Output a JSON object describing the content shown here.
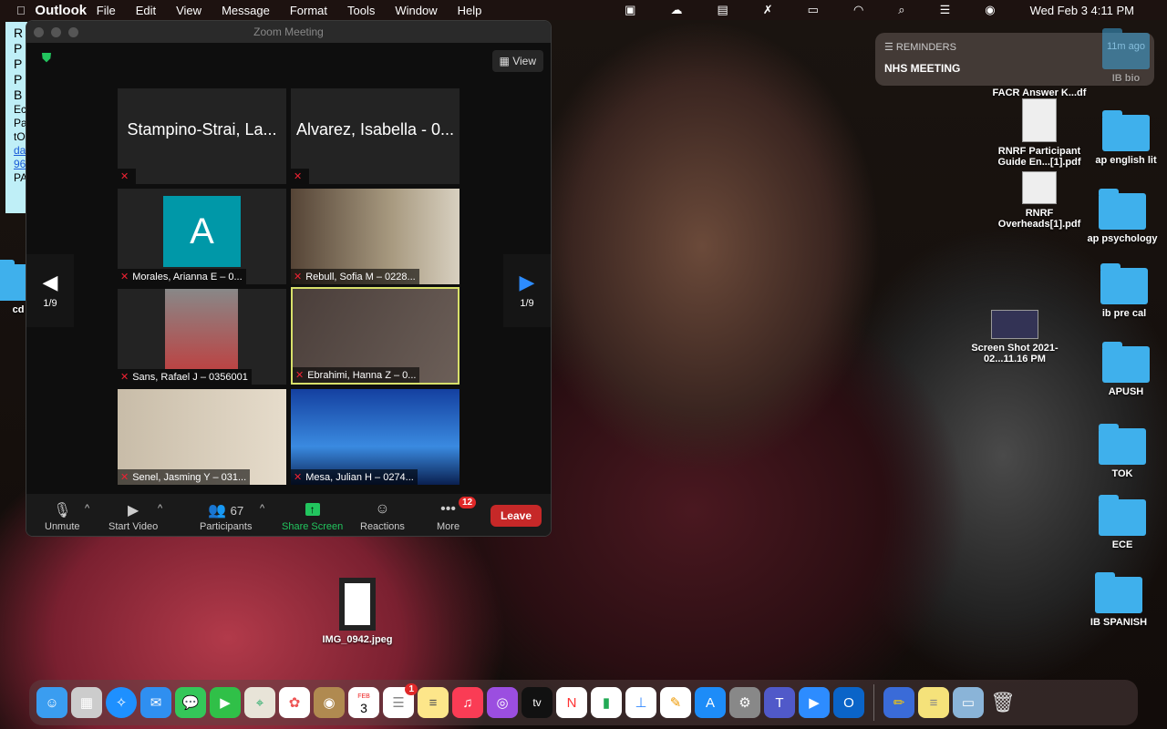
{
  "menubar": {
    "app": "Outlook",
    "items": [
      "File",
      "Edit",
      "View",
      "Message",
      "Format",
      "Tools",
      "Window",
      "Help"
    ],
    "datetime": "Wed Feb 3  4:11 PM"
  },
  "sticky": {
    "lines": [
      "R",
      "P",
      "P",
      "P",
      "B",
      "Ec",
      "Pa",
      "tO",
      "da",
      "96",
      "PA"
    ]
  },
  "zoom": {
    "title": "Zoom Meeting",
    "view_label": "View",
    "page": "1/9",
    "tiles": [
      {
        "name": "Stampino-Strai, La...",
        "label": ""
      },
      {
        "name": "Alvarez, Isabella - 0...",
        "label": ""
      },
      {
        "label": "Morales, Arianna E – 0...",
        "avatar": "A"
      },
      {
        "label": "Rebull, Sofia M – 0228..."
      },
      {
        "label": "Sans, Rafael J – 0356001"
      },
      {
        "label": "Ebrahimi, Hanna Z – 0..."
      },
      {
        "label": "Senel, Jasming Y – 031..."
      },
      {
        "label": "Mesa, Julian H – 0274..."
      }
    ],
    "toolbar": {
      "unmute": "Unmute",
      "start_video": "Start Video",
      "participants": "Participants",
      "participant_count": "67",
      "share": "Share Screen",
      "reactions": "Reactions",
      "more": "More",
      "more_badge": "12",
      "leave": "Leave"
    }
  },
  "notification": {
    "app": "REMINDERS",
    "time": "11m ago",
    "title": "NHS MEETING"
  },
  "desktop": {
    "files": [
      "FACR Answer K...df",
      "RNRF Participant Guide En...[1].pdf",
      "RNRF Overheads[1].pdf",
      "Screen Shot 2021-02...11.16 PM",
      "IMG_0942.jpeg"
    ],
    "folders": [
      "IB bio",
      "ap english lit",
      "ap psychology",
      "ib pre cal",
      "APUSH",
      "TOK",
      "ECE",
      "IB SPANISH"
    ],
    "left_folder": "cd"
  },
  "dock": {
    "calendar_month": "FEB",
    "calendar_day": "3",
    "reminders_badge": "1",
    "tv_label": "tv"
  }
}
